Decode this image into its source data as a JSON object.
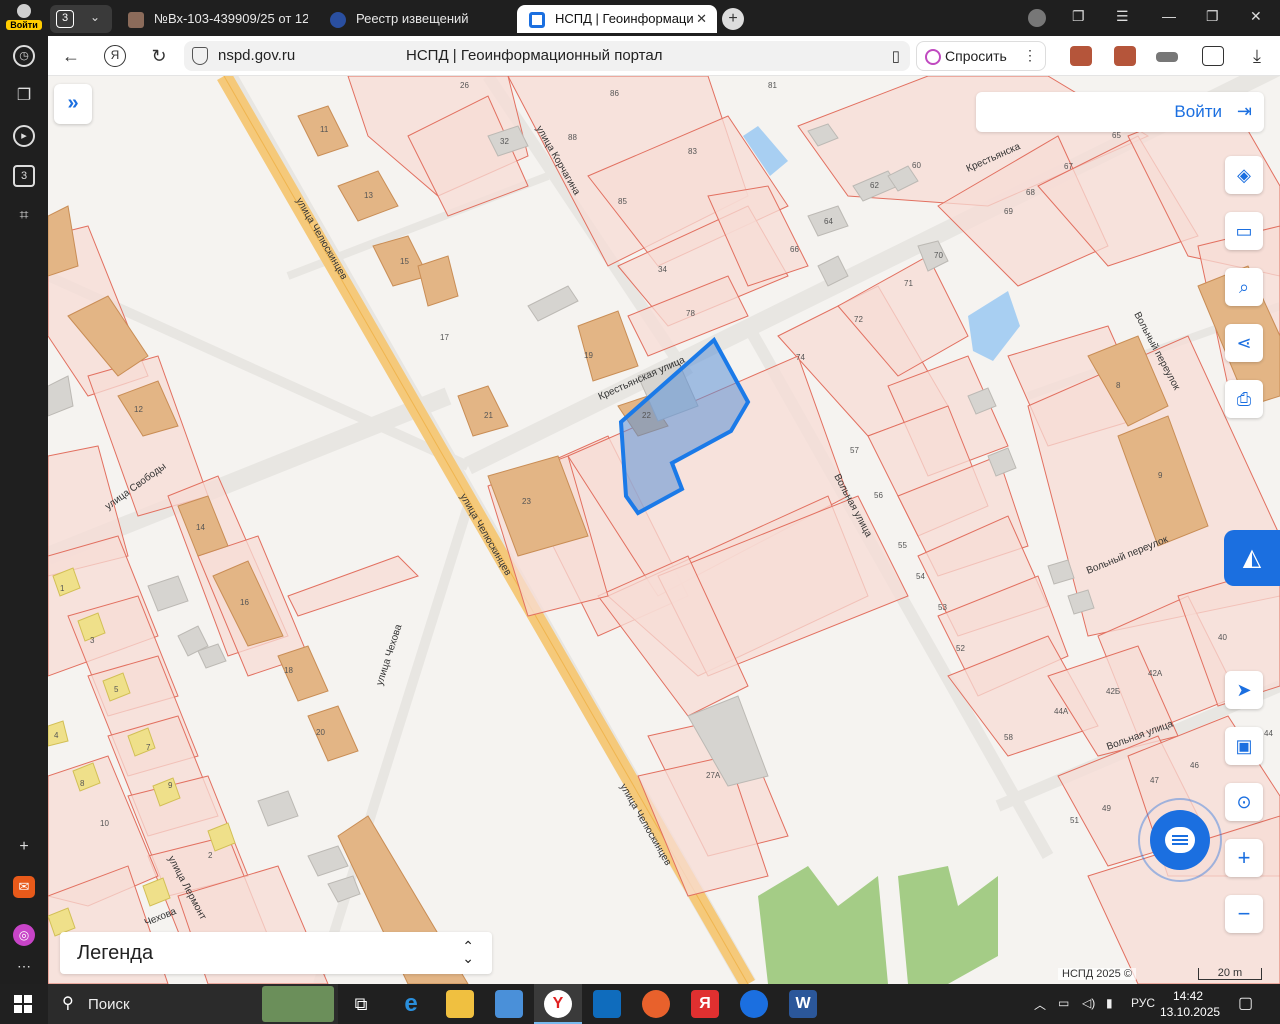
{
  "browser": {
    "sidebar": {
      "login_label": "Войти",
      "group_count": "3"
    },
    "tab_group_count": "3",
    "tabs": [
      {
        "title": "№Вх-103-439909/25 от 12"
      },
      {
        "title": "Реестр извещений"
      },
      {
        "title": "НСПД | Геоинформаци"
      }
    ],
    "url": "nspd.gov.ru",
    "page_title": "НСПД | Геоинформационный портал",
    "ask_label": "Спросить"
  },
  "map": {
    "login_label": "Войти",
    "legend_label": "Легенда",
    "copyright": "НСПД 2025 ©",
    "scale_label": "20 m",
    "streets": [
      {
        "name": "улица Челюскинцев"
      },
      {
        "name": "улица Челюскинцев"
      },
      {
        "name": "улица Челюскинцев"
      },
      {
        "name": "Крестьянская улица"
      },
      {
        "name": "Крестьянска"
      },
      {
        "name": "улица Корчагина"
      },
      {
        "name": "улица Свободы"
      },
      {
        "name": "улица Чехова"
      },
      {
        "name": "Вольная улица"
      },
      {
        "name": "Вольная улица"
      },
      {
        "name": "Вольный переулок"
      },
      {
        "name": "Вольный переулок"
      },
      {
        "name": "улица Лермонт"
      },
      {
        "name": "Чехова"
      }
    ],
    "house_numbers": [
      "26",
      "86",
      "81",
      "11",
      "32",
      "88",
      "83",
      "13",
      "85",
      "62",
      "60",
      "64",
      "66",
      "67",
      "68",
      "69",
      "15",
      "34",
      "70",
      "71",
      "17",
      "19",
      "72",
      "74",
      "78",
      "21",
      "22",
      "23",
      "57",
      "56",
      "55",
      "54",
      "53",
      "52",
      "14",
      "16",
      "18",
      "20",
      "12",
      "1",
      "3",
      "5",
      "7",
      "9",
      "4",
      "8",
      "10",
      "2",
      "27А",
      "42А",
      "42Б",
      "44А",
      "58",
      "47",
      "46",
      "49",
      "51",
      "8",
      "9",
      "40",
      "44",
      "65"
    ]
  },
  "taskbar": {
    "search_label": "Поиск",
    "lang": "РУС",
    "time": "14:42",
    "date": "13.10.2025"
  }
}
